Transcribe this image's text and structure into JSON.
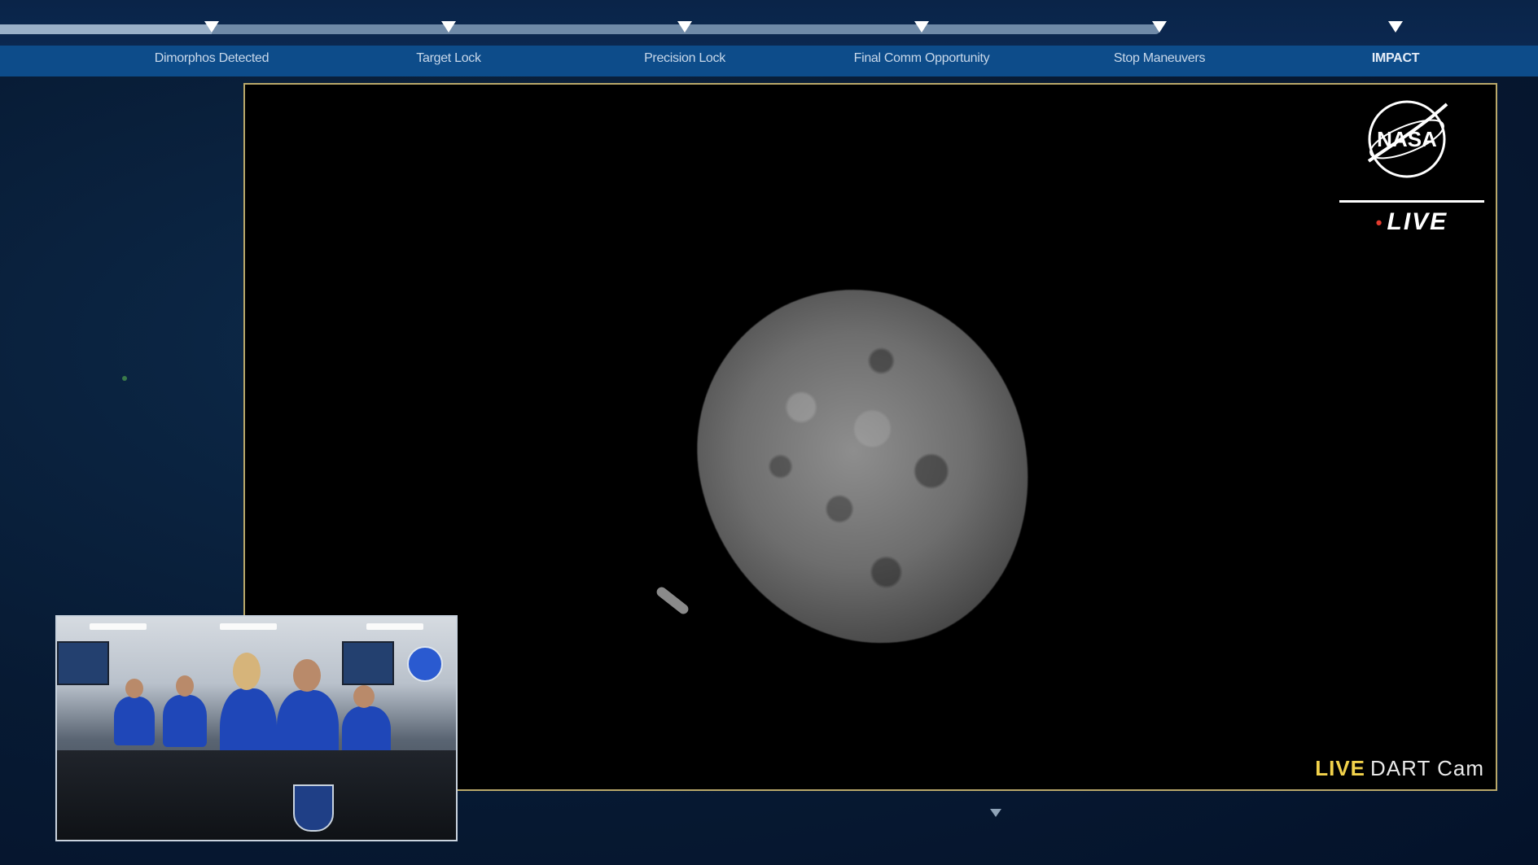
{
  "timeline": {
    "milestones": [
      {
        "label": "Dimorphos Detected"
      },
      {
        "label": "Target Lock"
      },
      {
        "label": "Precision Lock"
      },
      {
        "label": "Final Comm Opportunity"
      },
      {
        "label": "Stop Maneuvers"
      },
      {
        "label": "IMPACT"
      }
    ]
  },
  "feed": {
    "logo_text": "NASA",
    "live_badge": "LIVE",
    "caption_live": "LIVE",
    "caption_name": "DART Cam"
  },
  "icons": {
    "nasa_logo": "nasa-meatball-logo",
    "milestone_marker": "triangle-down",
    "pip_badge": "apl-shield"
  },
  "colors": {
    "background": "#071a33",
    "timeline_strip": "#0d4c8a",
    "feed_border": "#b9a86a",
    "live_yellow": "#f2d24b",
    "live_dot_red": "#e23b2e"
  }
}
